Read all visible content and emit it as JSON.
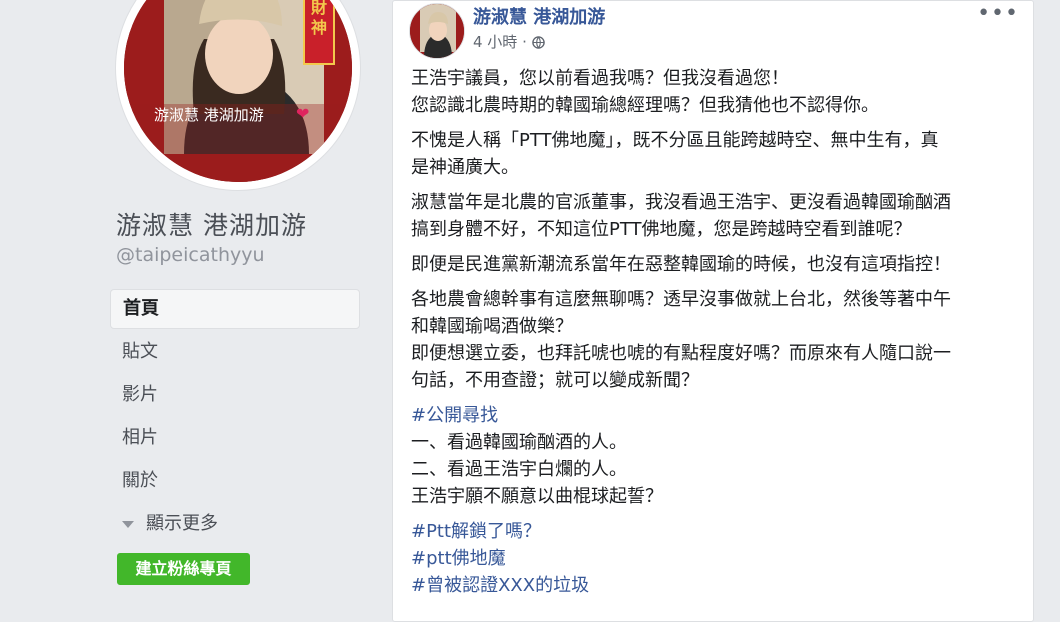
{
  "page": {
    "name": "游淑慧 港湖加游",
    "handle": "@taipeicathyyu",
    "avatar_caption": "游淑慧 港湖加游",
    "avatar_banner": "迎財神"
  },
  "nav": {
    "items": [
      {
        "label": "首頁",
        "active": true
      },
      {
        "label": "貼文"
      },
      {
        "label": "影片"
      },
      {
        "label": "相片"
      },
      {
        "label": "關於"
      }
    ],
    "more_label": "顯示更多"
  },
  "create_button": "建立粉絲專頁",
  "post": {
    "author": "游淑慧 港湖加游",
    "time": "4 小時",
    "audience_icon": "globe-icon",
    "menu_icon": "more-dots-icon",
    "paragraphs": [
      [
        "王浩宇議員，您以前看過我嗎？但我沒看過您！",
        "您認識北農時期的韓國瑜總經理嗎？但我猜他也不認得你。"
      ],
      [
        "不愧是人稱「PTT佛地魔」，既不分區且能跨越時空、無中生有，真",
        "是神通廣大。"
      ],
      [
        "淑慧當年是北農的官派董事，我沒看過王浩宇、更沒看過韓國瑜酗酒",
        "搞到身體不好，不知這位PTT佛地魔，您是跨越時空看到誰呢？"
      ],
      [
        "即便是民進黨新潮流系當年在惡整韓國瑜的時候，也沒有這項指控！"
      ],
      [
        "各地農會總幹事有這麼無聊嗎？透早沒事做就上台北，然後等著中午",
        "和韓國瑜喝酒做樂？",
        "即便想選立委，也拜託唬也唬的有點程度好嗎？而原來有人隨口說一",
        "句話，不用查證；就可以變成新聞？"
      ],
      [
        "#公開尋找",
        "一、看過韓國瑜酗酒的人。",
        "二、看過王浩宇白爛的人。",
        "王浩宇願不願意以曲棍球起誓？"
      ],
      [
        "#Ptt解鎖了嗎？",
        "#ptt佛地魔",
        "#曾被認證XXX的垃圾"
      ]
    ]
  }
}
